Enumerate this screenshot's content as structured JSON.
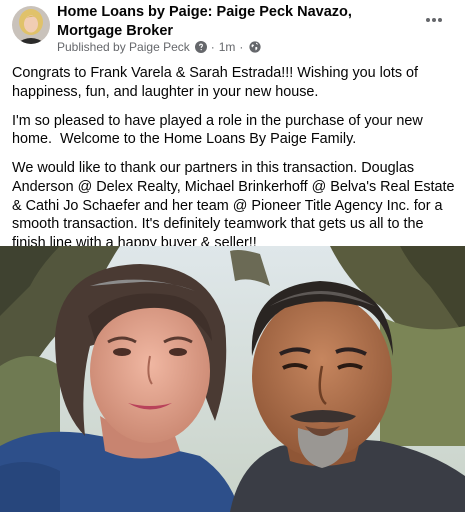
{
  "post": {
    "page_name": "Home Loans by Paige: Paige Peck Navazo, Mortgage Broker",
    "published_by": "Published by Paige Peck",
    "separator": "·",
    "time": "1m",
    "visibility_icon": "globe-icon",
    "verified_icon": "question-circle-icon",
    "more_icon": "ellipsis-icon",
    "paragraphs": [
      "Congrats to Frank Varela & Sarah Estrada!!! Wishing you lots of happiness, fun, and laughter in your new house.",
      "I'm so pleased to have played a role in the purchase of your new home.  Welcome to the Home Loans By Paige Family.",
      "We would like to thank our partners in this transaction. Douglas Anderson @ Delex Realty, Michael Brinkerhoff @ Belva's Real Estate & Cathi Jo Schaefer and her team @ Pioneer Title Agency Inc. for a smooth transaction. It's definitely teamwork that gets us all to the finish line with a happy buyer & seller!!"
    ]
  },
  "colors": {
    "text_primary": "#050505",
    "text_secondary": "#65676b",
    "background": "#ffffff"
  }
}
